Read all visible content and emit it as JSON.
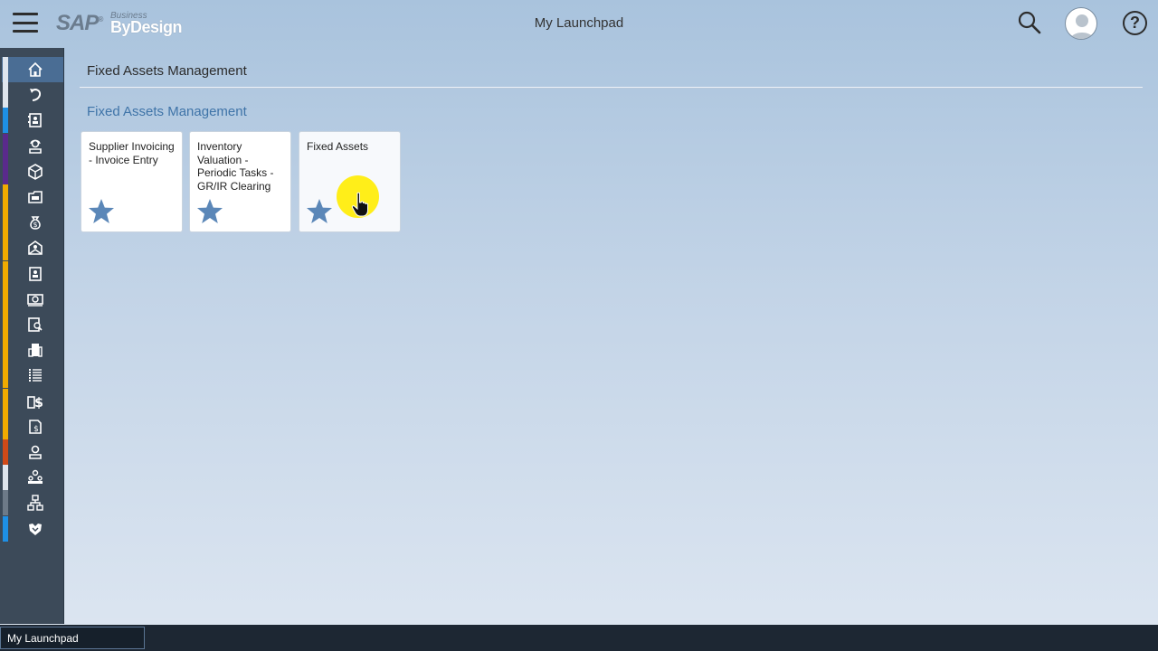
{
  "header": {
    "title": "My Launchpad",
    "logo_brand": "SAP",
    "logo_line1": "Business",
    "logo_line2": "ByDesign",
    "menu_icon": "hamburger-menu-icon",
    "search_icon": "search-icon",
    "avatar_icon": "user-avatar-icon",
    "help_label": "?"
  },
  "sidebar": {
    "items": [
      {
        "icon": "home-icon",
        "accent": "#dfe6ee",
        "active": true
      },
      {
        "icon": "refresh-arrow-icon",
        "accent": "#dfe6ee"
      },
      {
        "icon": "contact-card-icon",
        "accent": "#1e90e6"
      },
      {
        "icon": "customer-service-icon",
        "accent": "#5a2a8c"
      },
      {
        "icon": "product-box-icon",
        "accent": "#5a2a8c"
      },
      {
        "icon": "folder-icon",
        "accent": "#f0ab00"
      },
      {
        "icon": "money-bag-icon",
        "accent": "#f0ab00"
      },
      {
        "icon": "envelope-people-icon",
        "accent": "#f0ab00"
      },
      {
        "icon": "document-person-icon",
        "accent": "#f0ab00"
      },
      {
        "icon": "cash-icon",
        "accent": "#f0ab00"
      },
      {
        "icon": "person-document-icon",
        "accent": "#f0ab00"
      },
      {
        "icon": "building-icon",
        "accent": "#f0ab00"
      },
      {
        "icon": "list-icon",
        "accent": "#f0ab00"
      },
      {
        "icon": "cost-center-icon",
        "accent": "#f0ab00"
      },
      {
        "icon": "invoice-icon",
        "accent": "#f0ab00"
      },
      {
        "icon": "employee-icon",
        "accent": "#d04a18"
      },
      {
        "icon": "team-icon",
        "accent": "#dfe6ee"
      },
      {
        "icon": "org-chart-icon",
        "accent": "#6d7a88"
      },
      {
        "icon": "handshake-icon",
        "accent": "#1e90e6"
      }
    ]
  },
  "main": {
    "page_title": "Fixed Assets Management",
    "group_title": "Fixed Assets Management",
    "tiles": [
      {
        "label": "Supplier Invoicing - Invoice Entry",
        "icon": "star-icon"
      },
      {
        "label": "Inventory Valuation - Periodic Tasks - GR/IR Clearing",
        "icon": "star-icon"
      },
      {
        "label": "Fixed Assets",
        "icon": "star-icon"
      }
    ]
  },
  "bottom_bar": {
    "task_tab_label": "My Launchpad"
  },
  "colors": {
    "accent_blue": "#3f74a8",
    "star": "#5b87b8",
    "sidebar_bg": "#3c4a59",
    "cursor_highlight": "#ffec00"
  }
}
